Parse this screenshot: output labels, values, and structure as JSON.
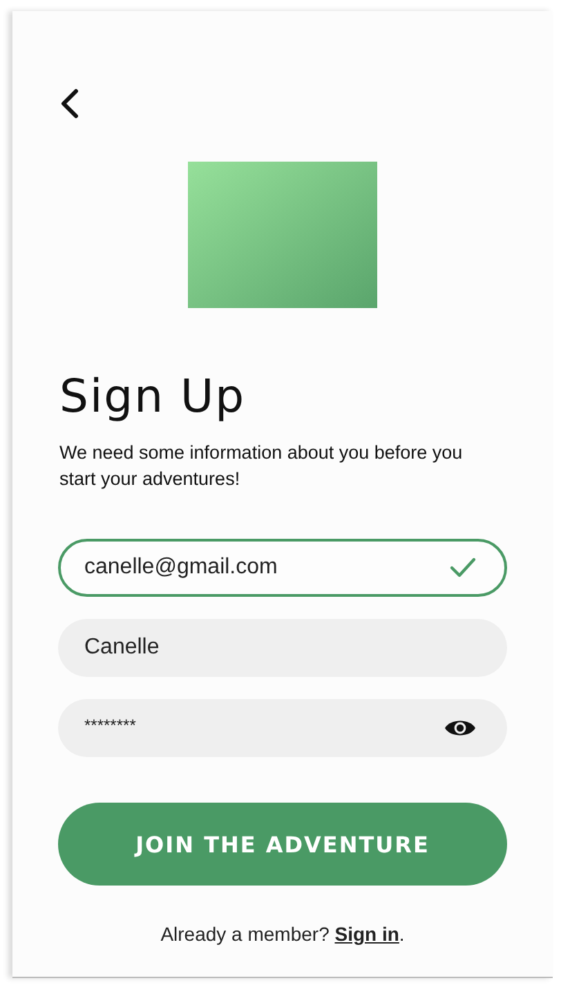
{
  "title": "Sign Up",
  "subtitle": "We need some information about you before you start your adventures!",
  "fields": [
    {
      "kind": "email",
      "value": "canelle@gmail.com",
      "valid": true
    },
    {
      "kind": "text",
      "value": "Canelle",
      "valid": false
    },
    {
      "kind": "password",
      "value": "********",
      "valid": false
    }
  ],
  "button": "JOIN THE ADVENTURE",
  "footer": {
    "text": "Already a member? ",
    "link": "Sign in",
    "after": "."
  }
}
